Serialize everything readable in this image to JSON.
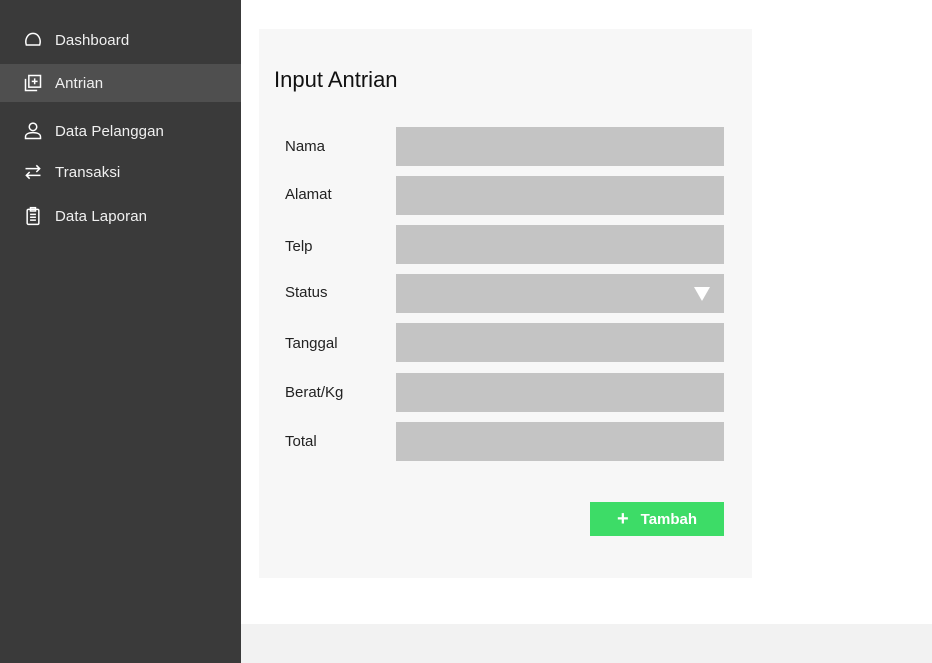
{
  "sidebar": {
    "items": [
      {
        "label": "Dashboard",
        "icon": "dashboard-icon",
        "active": false
      },
      {
        "label": "Antrian",
        "icon": "queue-add-icon",
        "active": true
      },
      {
        "label": "Data Pelanggan",
        "icon": "user-icon",
        "active": false
      },
      {
        "label": "Transaksi",
        "icon": "transfer-arrows-icon",
        "active": false
      },
      {
        "label": "Data  Laporan",
        "icon": "clipboard-icon",
        "active": false
      }
    ]
  },
  "form": {
    "title": "Input Antrian",
    "fields": [
      {
        "label": "Nama",
        "value": ""
      },
      {
        "label": "Alamat",
        "value": ""
      },
      {
        "label": "Telp",
        "value": ""
      },
      {
        "label": "Status",
        "value": ""
      },
      {
        "label": "Tanggal",
        "value": ""
      },
      {
        "label": "Berat/Kg",
        "value": ""
      },
      {
        "label": "Total",
        "value": ""
      }
    ],
    "submit_label": "Tambah",
    "submit_icon": "plus-icon"
  },
  "colors": {
    "sidebar_bg": "#3a3a3a",
    "sidebar_active_bg": "#4f4f4f",
    "input_bg": "#c4c4c4",
    "card_bg": "#f7f7f7",
    "accent_green": "#3ddc67"
  }
}
